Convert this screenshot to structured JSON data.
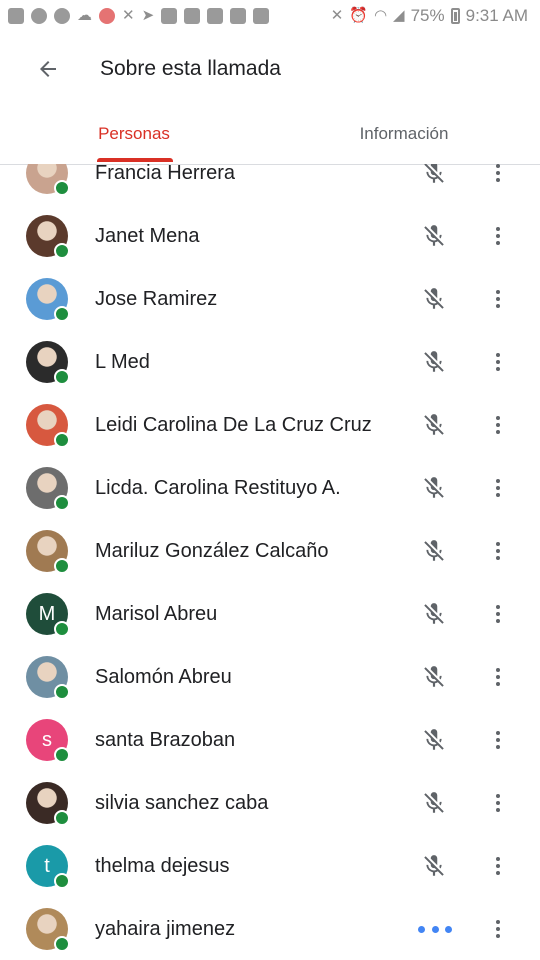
{
  "status_bar": {
    "left_icons": [
      "messages-icon",
      "whatsapp-icon",
      "facebook-icon",
      "weather-icon",
      "record-icon",
      "mute-icon",
      "telegram-icon",
      "video-icon",
      "gallery-icon",
      "app-icon",
      "app-icon",
      "youtube-icon"
    ],
    "battery_percent": "75%",
    "time": "9:31 AM"
  },
  "app_bar": {
    "title": "Sobre esta llamada"
  },
  "tabs": [
    {
      "label": "Personas",
      "active": true
    },
    {
      "label": "Información",
      "active": false
    }
  ],
  "colors": {
    "accent": "#d93025",
    "online": "#1e8e3e",
    "speaking": "#4285f4"
  },
  "participants": [
    {
      "name": "Francia Herrera",
      "avatar": "photo",
      "avatar_color": "#c9a38f",
      "state": "muted"
    },
    {
      "name": "Janet Mena",
      "avatar": "photo",
      "avatar_color": "#5b3a2c",
      "state": "muted"
    },
    {
      "name": "Jose Ramirez",
      "avatar": "photo",
      "avatar_color": "#5a9bd5",
      "state": "muted"
    },
    {
      "name": "L Med",
      "avatar": "photo",
      "avatar_color": "#2b2b2b",
      "state": "muted"
    },
    {
      "name": "Leidi Carolina De La Cruz Cruz",
      "avatar": "photo",
      "avatar_color": "#d7583f",
      "state": "muted"
    },
    {
      "name": "Licda. Carolina Restituyo A.",
      "avatar": "photo",
      "avatar_color": "#6d6d6d",
      "state": "muted"
    },
    {
      "name": "Mariluz González Calcaño",
      "avatar": "photo",
      "avatar_color": "#a07a52",
      "state": "muted"
    },
    {
      "name": "Marisol Abreu",
      "avatar": "letter",
      "letter": "M",
      "avatar_color": "#1f4d3a",
      "state": "muted"
    },
    {
      "name": "Salomón Abreu",
      "avatar": "photo",
      "avatar_color": "#6f8fa3",
      "state": "muted"
    },
    {
      "name": "santa Brazoban",
      "avatar": "letter",
      "letter": "s",
      "avatar_color": "#e8457a",
      "state": "muted"
    },
    {
      "name": "silvia sanchez caba",
      "avatar": "photo",
      "avatar_color": "#3a2a25",
      "state": "muted"
    },
    {
      "name": "thelma dejesus",
      "avatar": "letter",
      "letter": "t",
      "avatar_color": "#1a9aa8",
      "state": "muted"
    },
    {
      "name": "yahaira jimenez",
      "avatar": "photo",
      "avatar_color": "#b08a5a",
      "state": "speaking"
    }
  ]
}
